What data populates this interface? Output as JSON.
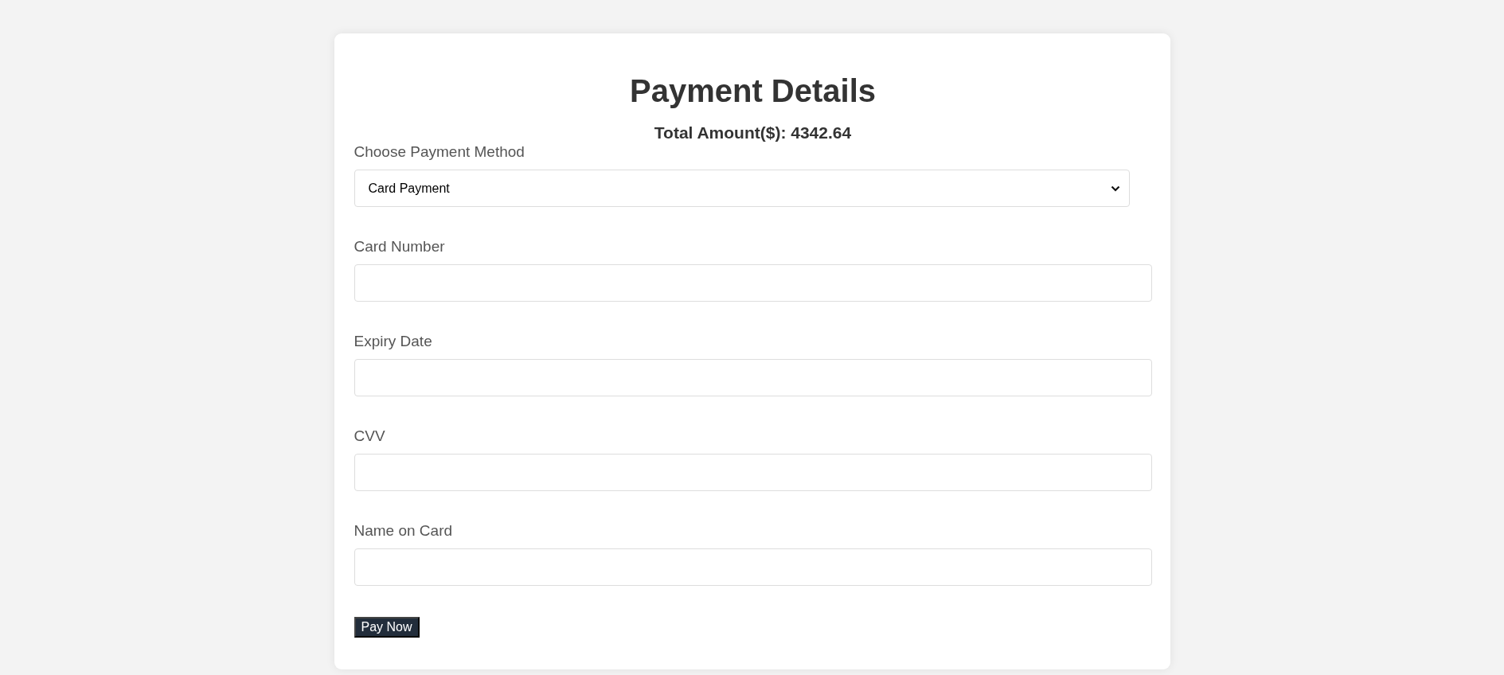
{
  "title": "Payment Details",
  "total": "Total Amount($): 4342.64",
  "fields": [
    {
      "kind": "select",
      "label": "Choose Payment Method",
      "value": "Card Payment"
    },
    {
      "kind": "text",
      "label": "Card Number"
    },
    {
      "kind": "text",
      "label": "Expiry Date"
    },
    {
      "kind": "text",
      "label": "CVV"
    },
    {
      "kind": "text",
      "label": "Name on Card"
    }
  ],
  "button": "Pay Now"
}
